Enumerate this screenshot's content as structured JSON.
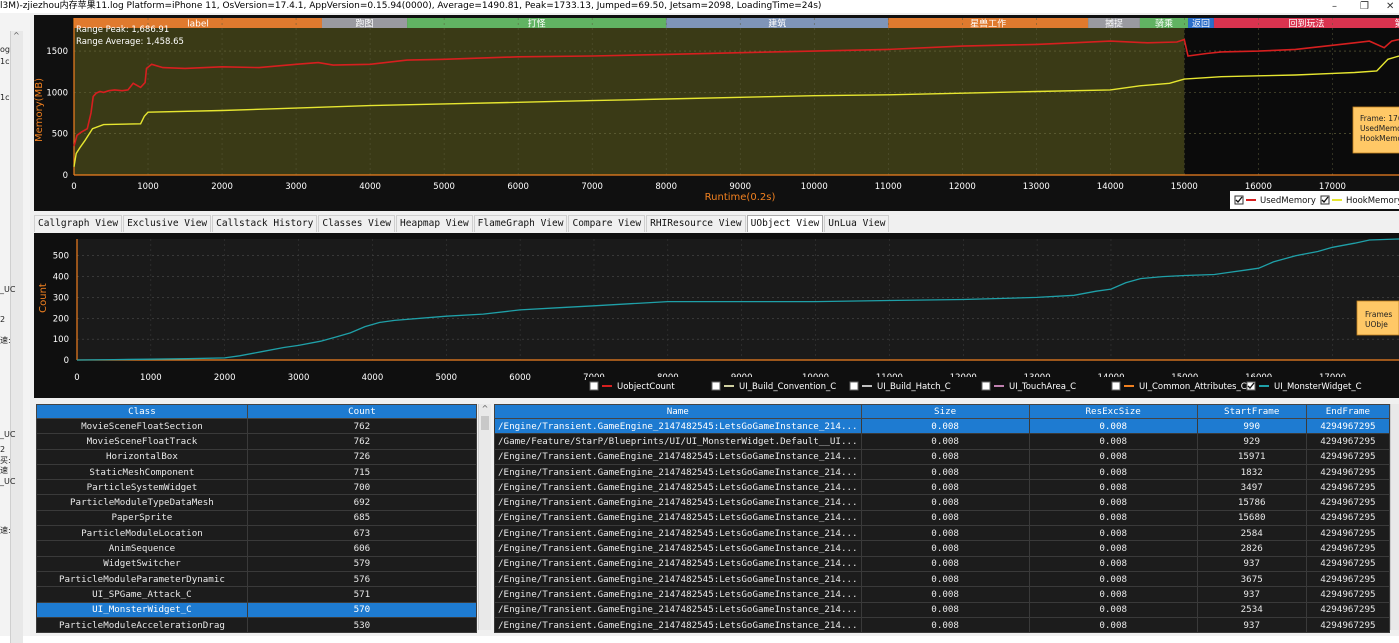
{
  "window": {
    "title": "l3M)-zjiezhou内存苹果11.log  Platform=iPhone 11, OsVersion=17.4.1, AppVersion=0.15.94(0000), Average=1490.81, Peak=1733.13, Jumped=69.50, Jetsam=2098, LoadingTime=24s)",
    "minimize": "–",
    "maximize": "❐",
    "close": "✕"
  },
  "left_gutter": [
    "og",
    "1c",
    "1c",
    "_UC",
    "2",
    "速:",
    "_UC",
    "2",
    "买:",
    "速",
    "_UC",
    "速:"
  ],
  "colors": {
    "plot_bg_olive": "#3a3a16",
    "plot_bg_dark": "#0b0b0b",
    "used_memory": "#d61f1f",
    "hook_memory": "#e6e630",
    "uobject_line": "#1fa0a8",
    "axis_orange": "#f08020",
    "selection_blue": "#1e7bd1"
  },
  "memory_chart": {
    "range_peak": "Range Peak: 1,686.91",
    "range_average": "Range Average: 1,458.65",
    "ylabel": "Memory(MB)",
    "xlabel": "Runtime(0.2s)",
    "y_ticks": [
      "0",
      "500",
      "1000",
      "1500"
    ],
    "x_ticks": [
      "0",
      "1000",
      "2000",
      "3000",
      "4000",
      "5000",
      "6000",
      "7000",
      "8000",
      "9000",
      "10000",
      "11000",
      "12000",
      "13000",
      "14000",
      "15000",
      "16000",
      "17000"
    ],
    "label_bands": [
      {
        "text": "label",
        "start": 0,
        "end": 3350,
        "color": "#e07a2e"
      },
      {
        "text": "跑图",
        "start": 3350,
        "end": 4500,
        "color": "#9a9aa0"
      },
      {
        "text": "打怪",
        "start": 4500,
        "end": 8000,
        "color": "#61b362"
      },
      {
        "text": "建筑",
        "start": 8000,
        "end": 11000,
        "color": "#7f95b8"
      },
      {
        "text": "星兽工作",
        "start": 11000,
        "end": 13700,
        "color": "#e07a2e"
      },
      {
        "text": "捕捉",
        "start": 13700,
        "end": 14400,
        "color": "#9a9aa0"
      },
      {
        "text": "骑乘",
        "start": 14400,
        "end": 15050,
        "color": "#61b362"
      },
      {
        "text": "返回",
        "start": 15050,
        "end": 15400,
        "color": "#2b6ec9"
      },
      {
        "text": "回到玩法",
        "start": 15400,
        "end": 17900,
        "color": "#d9334f"
      },
      {
        "text": "第",
        "start": 17900,
        "end": 18200,
        "color": "#e07a2e"
      }
    ],
    "highlight_end_x": 15000,
    "xlim": [
      0,
      17900
    ],
    "ylim": [
      0,
      1900
    ],
    "used_memory": [
      [
        0,
        350
      ],
      [
        40,
        480
      ],
      [
        100,
        520
      ],
      [
        180,
        560
      ],
      [
        230,
        750
      ],
      [
        260,
        950
      ],
      [
        300,
        990
      ],
      [
        350,
        1010
      ],
      [
        400,
        1000
      ],
      [
        470,
        1020
      ],
      [
        550,
        1030
      ],
      [
        650,
        1020
      ],
      [
        730,
        1030
      ],
      [
        800,
        1110
      ],
      [
        900,
        1060
      ],
      [
        960,
        1120
      ],
      [
        980,
        1290
      ],
      [
        1050,
        1340
      ],
      [
        1200,
        1300
      ],
      [
        1500,
        1290
      ],
      [
        2000,
        1310
      ],
      [
        2500,
        1300
      ],
      [
        3000,
        1340
      ],
      [
        3300,
        1360
      ],
      [
        3500,
        1330
      ],
      [
        4000,
        1340
      ],
      [
        4500,
        1390
      ],
      [
        5000,
        1400
      ],
      [
        6000,
        1430
      ],
      [
        7000,
        1440
      ],
      [
        8000,
        1460
      ],
      [
        9000,
        1480
      ],
      [
        10000,
        1500
      ],
      [
        11000,
        1520
      ],
      [
        12000,
        1560
      ],
      [
        13000,
        1580
      ],
      [
        13500,
        1600
      ],
      [
        14000,
        1620
      ],
      [
        14500,
        1600
      ],
      [
        14900,
        1610
      ],
      [
        15000,
        1640
      ],
      [
        15050,
        1440
      ],
      [
        15300,
        1470
      ],
      [
        15500,
        1490
      ],
      [
        16000,
        1500
      ],
      [
        16500,
        1520
      ],
      [
        17000,
        1570
      ],
      [
        17300,
        1600
      ],
      [
        17500,
        1620
      ],
      [
        17700,
        1540
      ],
      [
        17800,
        1620
      ],
      [
        17900,
        1640
      ]
    ],
    "hook_memory": [
      [
        0,
        100
      ],
      [
        30,
        260
      ],
      [
        80,
        330
      ],
      [
        150,
        420
      ],
      [
        250,
        560
      ],
      [
        400,
        610
      ],
      [
        900,
        620
      ],
      [
        950,
        710
      ],
      [
        1000,
        760
      ],
      [
        2000,
        780
      ],
      [
        3000,
        810
      ],
      [
        4000,
        840
      ],
      [
        5000,
        860
      ],
      [
        6000,
        880
      ],
      [
        7000,
        900
      ],
      [
        8000,
        920
      ],
      [
        9000,
        940
      ],
      [
        10000,
        960
      ],
      [
        11000,
        970
      ],
      [
        12000,
        990
      ],
      [
        13000,
        1010
      ],
      [
        14000,
        1030
      ],
      [
        14400,
        1080
      ],
      [
        14800,
        1110
      ],
      [
        15000,
        1160
      ],
      [
        15500,
        1190
      ],
      [
        16000,
        1200
      ],
      [
        16500,
        1210
      ],
      [
        17000,
        1230
      ],
      [
        17300,
        1240
      ],
      [
        17600,
        1260
      ],
      [
        17750,
        1400
      ],
      [
        17900,
        1440
      ]
    ],
    "tooltip": [
      "Frame: 176",
      "UsedMemo",
      "HookMemo"
    ],
    "legend": [
      {
        "name": "UsedMemory",
        "checked": true,
        "color": "#d61f1f"
      },
      {
        "name": "HookMemory",
        "checked": true,
        "color": "#e6e630"
      }
    ]
  },
  "tabs": [
    {
      "label": "Callgraph View",
      "active": false
    },
    {
      "label": "Exclusive View",
      "active": false
    },
    {
      "label": "Callstack History",
      "active": false
    },
    {
      "label": "Classes View",
      "active": false
    },
    {
      "label": "Heapmap View",
      "active": false
    },
    {
      "label": "FlameGraph View",
      "active": false
    },
    {
      "label": "Compare View",
      "active": false
    },
    {
      "label": "RHIResource View",
      "active": false
    },
    {
      "label": "UObject View",
      "active": true
    },
    {
      "label": "UnLua View",
      "active": false
    }
  ],
  "uobject_chart": {
    "ylabel": "Count",
    "y_ticks": [
      "0",
      "100",
      "200",
      "300",
      "400",
      "500"
    ],
    "x_ticks": [
      "0",
      "1000",
      "2000",
      "3000",
      "4000",
      "5000",
      "6000",
      "7000",
      "8000",
      "9000",
      "10000",
      "11000",
      "12000",
      "13000",
      "14000",
      "15000",
      "16000",
      "17000"
    ],
    "xlim": [
      0,
      17900
    ],
    "ylim": [
      0,
      580
    ],
    "series": [
      [
        0,
        0
      ],
      [
        500,
        2
      ],
      [
        1000,
        4
      ],
      [
        1500,
        6
      ],
      [
        2000,
        10
      ],
      [
        2200,
        20
      ],
      [
        2500,
        40
      ],
      [
        2800,
        60
      ],
      [
        3000,
        70
      ],
      [
        3300,
        90
      ],
      [
        3500,
        110
      ],
      [
        3700,
        130
      ],
      [
        3900,
        160
      ],
      [
        4100,
        180
      ],
      [
        4300,
        190
      ],
      [
        5000,
        210
      ],
      [
        5500,
        220
      ],
      [
        6000,
        240
      ],
      [
        6500,
        250
      ],
      [
        7000,
        260
      ],
      [
        7500,
        270
      ],
      [
        8000,
        280
      ],
      [
        9000,
        280
      ],
      [
        10000,
        280
      ],
      [
        11000,
        285
      ],
      [
        12000,
        290
      ],
      [
        13000,
        300
      ],
      [
        13500,
        310
      ],
      [
        13800,
        330
      ],
      [
        14000,
        340
      ],
      [
        14200,
        370
      ],
      [
        14400,
        390
      ],
      [
        14700,
        400
      ],
      [
        15000,
        405
      ],
      [
        15400,
        410
      ],
      [
        15600,
        420
      ],
      [
        15800,
        430
      ],
      [
        16000,
        440
      ],
      [
        16200,
        470
      ],
      [
        16500,
        500
      ],
      [
        16800,
        520
      ],
      [
        17000,
        540
      ],
      [
        17300,
        560
      ],
      [
        17500,
        575
      ],
      [
        17900,
        580
      ]
    ],
    "tooltip": [
      "Frames",
      "UObje"
    ],
    "legend": [
      {
        "name": "UobjectCount",
        "checked": false,
        "color": "#d61f1f"
      },
      {
        "name": "UI_Build_Convention_C",
        "checked": false,
        "color": "#d0d0a0"
      },
      {
        "name": "UI_Build_Hatch_C",
        "checked": false,
        "color": "#c0c0c0"
      },
      {
        "name": "UI_TouchArea_C",
        "checked": false,
        "color": "#c080b0"
      },
      {
        "name": "UI_Common_Attributes_C",
        "checked": false,
        "color": "#f08020"
      },
      {
        "name": "UI_MonsterWidget_C",
        "checked": true,
        "color": "#1fa0a8"
      }
    ]
  },
  "class_table": {
    "headers": [
      "Class",
      "Count"
    ],
    "rows": [
      {
        "class": "MovieSceneFloatSection",
        "count": "762",
        "selected": false
      },
      {
        "class": "MovieSceneFloatTrack",
        "count": "762",
        "selected": false
      },
      {
        "class": "HorizontalBox",
        "count": "726",
        "selected": false
      },
      {
        "class": "StaticMeshComponent",
        "count": "715",
        "selected": false
      },
      {
        "class": "ParticleSystemWidget",
        "count": "700",
        "selected": false
      },
      {
        "class": "ParticleModuleTypeDataMesh",
        "count": "692",
        "selected": false
      },
      {
        "class": "PaperSprite",
        "count": "685",
        "selected": false
      },
      {
        "class": "ParticleModuleLocation",
        "count": "673",
        "selected": false
      },
      {
        "class": "AnimSequence",
        "count": "606",
        "selected": false
      },
      {
        "class": "WidgetSwitcher",
        "count": "579",
        "selected": false
      },
      {
        "class": "ParticleModuleParameterDynamic",
        "count": "576",
        "selected": false
      },
      {
        "class": "UI_SPGame_Attack_C",
        "count": "571",
        "selected": false
      },
      {
        "class": "UI_MonsterWidget_C",
        "count": "570",
        "selected": true
      },
      {
        "class": "ParticleModuleAccelerationDrag",
        "count": "530",
        "selected": false
      }
    ]
  },
  "object_table": {
    "headers": [
      "Name",
      "Size",
      "ResExcSize",
      "StartFrame",
      "EndFrame"
    ],
    "rows": [
      {
        "name": "/Engine/Transient.GameEngine_2147482545:LetsGoGameInstance_214...",
        "size": "0.008",
        "res": "0.008",
        "start": "990",
        "end": "4294967295",
        "selected": true
      },
      {
        "name": "/Game/Feature/StarP/Blueprints/UI/UI_MonsterWidget.Default__UI...",
        "size": "0.008",
        "res": "0.008",
        "start": "929",
        "end": "4294967295",
        "selected": false
      },
      {
        "name": "/Engine/Transient.GameEngine_2147482545:LetsGoGameInstance_214...",
        "size": "0.008",
        "res": "0.008",
        "start": "15971",
        "end": "4294967295",
        "selected": false
      },
      {
        "name": "/Engine/Transient.GameEngine_2147482545:LetsGoGameInstance_214...",
        "size": "0.008",
        "res": "0.008",
        "start": "1832",
        "end": "4294967295",
        "selected": false
      },
      {
        "name": "/Engine/Transient.GameEngine_2147482545:LetsGoGameInstance_214...",
        "size": "0.008",
        "res": "0.008",
        "start": "3497",
        "end": "4294967295",
        "selected": false
      },
      {
        "name": "/Engine/Transient.GameEngine_2147482545:LetsGoGameInstance_214...",
        "size": "0.008",
        "res": "0.008",
        "start": "15786",
        "end": "4294967295",
        "selected": false
      },
      {
        "name": "/Engine/Transient.GameEngine_2147482545:LetsGoGameInstance_214...",
        "size": "0.008",
        "res": "0.008",
        "start": "15680",
        "end": "4294967295",
        "selected": false
      },
      {
        "name": "/Engine/Transient.GameEngine_2147482545:LetsGoGameInstance_214...",
        "size": "0.008",
        "res": "0.008",
        "start": "2584",
        "end": "4294967295",
        "selected": false
      },
      {
        "name": "/Engine/Transient.GameEngine_2147482545:LetsGoGameInstance_214...",
        "size": "0.008",
        "res": "0.008",
        "start": "2826",
        "end": "4294967295",
        "selected": false
      },
      {
        "name": "/Engine/Transient.GameEngine_2147482545:LetsGoGameInstance_214...",
        "size": "0.008",
        "res": "0.008",
        "start": "937",
        "end": "4294967295",
        "selected": false
      },
      {
        "name": "/Engine/Transient.GameEngine_2147482545:LetsGoGameInstance_214...",
        "size": "0.008",
        "res": "0.008",
        "start": "3675",
        "end": "4294967295",
        "selected": false
      },
      {
        "name": "/Engine/Transient.GameEngine_2147482545:LetsGoGameInstance_214...",
        "size": "0.008",
        "res": "0.008",
        "start": "937",
        "end": "4294967295",
        "selected": false
      },
      {
        "name": "/Engine/Transient.GameEngine_2147482545:LetsGoGameInstance_214...",
        "size": "0.008",
        "res": "0.008",
        "start": "2534",
        "end": "4294967295",
        "selected": false
      },
      {
        "name": "/Engine/Transient.GameEngine_2147482545:LetsGoGameInstance_214...",
        "size": "0.008",
        "res": "0.008",
        "start": "937",
        "end": "4294967295",
        "selected": false
      }
    ]
  },
  "scroll": {
    "up": "^"
  },
  "chart_data": [
    {
      "type": "line",
      "title": "",
      "xlabel": "Runtime(0.2s)",
      "ylabel": "Memory(MB)",
      "xlim": [
        0,
        17900
      ],
      "ylim": [
        0,
        1900
      ],
      "series": [
        {
          "name": "UsedMemory",
          "ref": "memory_chart.used_memory"
        },
        {
          "name": "HookMemory",
          "ref": "memory_chart.hook_memory"
        }
      ]
    },
    {
      "type": "line",
      "title": "",
      "xlabel": "",
      "ylabel": "Count",
      "xlim": [
        0,
        17900
      ],
      "ylim": [
        0,
        580
      ],
      "series": [
        {
          "name": "UI_MonsterWidget_C",
          "ref": "uobject_chart.series"
        }
      ]
    }
  ]
}
